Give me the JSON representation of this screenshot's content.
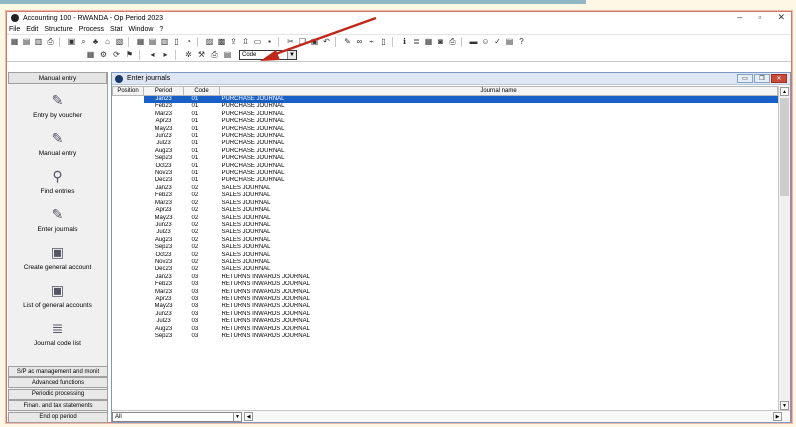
{
  "window": {
    "title": "Accounting 100 - RWANDA - Op Period 2023",
    "controls": [
      "–",
      "▫",
      "✕"
    ]
  },
  "menu": [
    "File",
    "Edit",
    "Structure",
    "Process",
    "Stat",
    "Window",
    "?"
  ],
  "toolbar": {
    "row1_icons": [
      "calc-icon",
      "card-icon",
      "grid-icon",
      "print-icon",
      "book-icon",
      "search-icon",
      "tree-icon",
      "bank-icon",
      "chart-icon",
      "table-icon",
      "table2-icon",
      "table3-icon",
      "doc-icon",
      "pie-icon",
      "report-icon",
      "report2-icon",
      "export-icon",
      "export2-icon",
      "folder-icon",
      "save-icon",
      "cut-icon",
      "copy-icon",
      "paste-icon",
      "undo-icon",
      "pen-icon",
      "glasses-icon",
      "brush-icon",
      "page-icon",
      "info-icon",
      "list-icon",
      "calc2-icon",
      "disk-icon",
      "print2-icon",
      "lock-icon",
      "people-icon",
      "check-icon",
      "form-icon",
      "help-icon"
    ],
    "combo_value": "Code"
  },
  "left": {
    "header": "Manual entry",
    "items": [
      {
        "label": "Entry by voucher",
        "icon": "pen-icon"
      },
      {
        "label": "Manual entry",
        "icon": "pen-icon"
      },
      {
        "label": "Find entries",
        "icon": "magnify-icon"
      },
      {
        "label": "Enter journals",
        "icon": "pen-icon"
      },
      {
        "label": "Create general account",
        "icon": "book-icon"
      },
      {
        "label": "List of general accounts",
        "icon": "book-icon"
      },
      {
        "label": "Journal code list",
        "icon": "list-icon"
      }
    ],
    "bottom_buttons": [
      "S/P ac management and monit",
      "Advanced functions",
      "Periodic processing",
      "Finan. and tax statements",
      "End op period"
    ]
  },
  "journals": {
    "title": "Enter journals",
    "columns": [
      "Position",
      "Period",
      "Code",
      "Journal name"
    ],
    "rows": [
      [
        "Jan23",
        "01",
        "PURCHASE JOURNAL"
      ],
      [
        "Feb23",
        "01",
        "PURCHASE JOURNAL"
      ],
      [
        "Mar23",
        "01",
        "PURCHASE JOURNAL"
      ],
      [
        "Apr23",
        "01",
        "PURCHASE JOURNAL"
      ],
      [
        "May23",
        "01",
        "PURCHASE JOURNAL"
      ],
      [
        "Jun23",
        "01",
        "PURCHASE JOURNAL"
      ],
      [
        "Jul23",
        "01",
        "PURCHASE JOURNAL"
      ],
      [
        "Aug23",
        "01",
        "PURCHASE JOURNAL"
      ],
      [
        "Sep23",
        "01",
        "PURCHASE JOURNAL"
      ],
      [
        "Oct23",
        "01",
        "PURCHASE JOURNAL"
      ],
      [
        "Nov23",
        "01",
        "PURCHASE JOURNAL"
      ],
      [
        "Dec23",
        "01",
        "PURCHASE JOURNAL"
      ],
      [
        "Jan23",
        "02",
        "SALES JOURNAL"
      ],
      [
        "Feb23",
        "02",
        "SALES JOURNAL"
      ],
      [
        "Mar23",
        "02",
        "SALES JOURNAL"
      ],
      [
        "Apr23",
        "02",
        "SALES JOURNAL"
      ],
      [
        "May23",
        "02",
        "SALES JOURNAL"
      ],
      [
        "Jun23",
        "02",
        "SALES JOURNAL"
      ],
      [
        "Jul23",
        "02",
        "SALES JOURNAL"
      ],
      [
        "Aug23",
        "02",
        "SALES JOURNAL"
      ],
      [
        "Sep23",
        "02",
        "SALES JOURNAL"
      ],
      [
        "Oct23",
        "02",
        "SALES JOURNAL"
      ],
      [
        "Nov23",
        "02",
        "SALES JOURNAL"
      ],
      [
        "Dec23",
        "02",
        "SALES JOURNAL"
      ],
      [
        "Jan23",
        "03",
        "RETURNS INWARDS JOURNAL"
      ],
      [
        "Feb23",
        "03",
        "RETURNS INWARDS JOURNAL"
      ],
      [
        "Mar23",
        "03",
        "RETURNS INWARDS JOURNAL"
      ],
      [
        "Apr23",
        "03",
        "RETURNS INWARDS JOURNAL"
      ],
      [
        "May23",
        "03",
        "RETURNS INWARDS JOURNAL"
      ],
      [
        "Jun23",
        "03",
        "RETURNS INWARDS JOURNAL"
      ],
      [
        "Jul23",
        "03",
        "RETURNS INWARDS JOURNAL"
      ],
      [
        "Aug23",
        "03",
        "RETURNS INWARDS JOURNAL"
      ],
      [
        "Sep23",
        "03",
        "RETURNS INWARDS JOURNAL"
      ]
    ],
    "filter_value": "All",
    "selected_index": 0
  },
  "colors": {
    "selection": "#1860c8",
    "arrow": "#c0281c"
  }
}
